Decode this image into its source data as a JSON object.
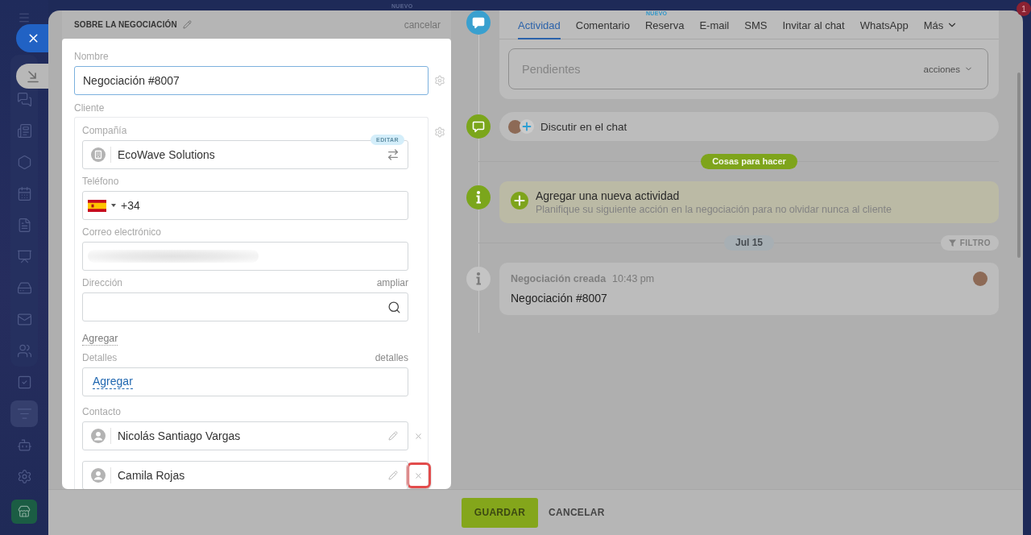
{
  "top_bar": {
    "tag": "NUEVO",
    "notification_count": "1"
  },
  "sidebar": {
    "items": [
      {
        "kind": "icon",
        "selected": false
      },
      {
        "kind": "icon",
        "selected": false
      },
      {
        "kind": "icon",
        "selected": false
      },
      {
        "kind": "icon",
        "selected": false
      },
      {
        "kind": "icon",
        "selected": false
      },
      {
        "kind": "icon",
        "selected": false
      },
      {
        "kind": "icon",
        "selected": false
      },
      {
        "kind": "icon",
        "selected": false
      },
      {
        "kind": "icon",
        "selected": false
      },
      {
        "kind": "icon",
        "selected": false
      },
      {
        "kind": "icon",
        "selected": true
      },
      {
        "kind": "icon",
        "selected": false
      },
      {
        "kind": "icon",
        "selected": false
      },
      {
        "kind": "tile",
        "selected": false
      }
    ]
  },
  "deal_form": {
    "title": "SOBRE LA NEGOCIACIÓN",
    "cancel_link": "cancelar",
    "name_field": {
      "label": "Nombre",
      "value": "Negociación #8007",
      "focused": true
    },
    "client": {
      "label": "Cliente",
      "company": {
        "label": "Compañía",
        "badge": "EDITAR",
        "value": "EcoWave Solutions"
      },
      "phone": {
        "label": "Teléfono",
        "country_code": "+34"
      },
      "email": {
        "label": "Correo electrónico",
        "redacted": true
      },
      "address": {
        "label": "Dirección",
        "action": "ampliar",
        "add_link": "Agregar"
      },
      "details": {
        "label": "Detalles",
        "action": "detalles",
        "link": "Agregar"
      },
      "contacts": {
        "label": "Contacto",
        "items": [
          {
            "name": "Nicolás Santiago Vargas",
            "highlighted": false
          },
          {
            "name": "Camila Rojas",
            "highlighted": true
          }
        ]
      }
    }
  },
  "timeline": {
    "tabs": [
      {
        "label": "Actividad",
        "selected": true,
        "kind": "tab"
      },
      {
        "label": "Comentario",
        "selected": false,
        "kind": "tab"
      },
      {
        "label": "Reserva",
        "selected": false,
        "kind": "tab",
        "badge": "NUEVO"
      },
      {
        "label": "E-mail",
        "selected": false,
        "kind": "tab"
      },
      {
        "label": "SMS",
        "selected": false,
        "kind": "tab"
      },
      {
        "label": "Invitar al chat",
        "selected": false,
        "kind": "tab"
      },
      {
        "label": "WhatsApp",
        "selected": false,
        "kind": "tab"
      },
      {
        "label": "Más",
        "selected": false,
        "kind": "menu"
      }
    ],
    "pending": {
      "title": "Pendientes",
      "actions": "acciones"
    },
    "chat": {
      "label": "Discutir en el chat"
    },
    "todo_divider": "Cosas para hacer",
    "new_activity": {
      "title": "Agregar una nueva actividad",
      "subtitle": "Planifique su siguiente acción en la negociación para no olvidar nunca al cliente"
    },
    "date_divider": "Jul 15",
    "filter_button": "FILTRO",
    "events": [
      {
        "title": "Negociación creada",
        "time": "10:43 pm",
        "text": "Negociación #8007"
      }
    ]
  },
  "footer": {
    "buttons": [
      {
        "label": "GUARDAR",
        "kind": "primary"
      },
      {
        "label": "CANCELAR",
        "kind": "link"
      }
    ]
  }
}
